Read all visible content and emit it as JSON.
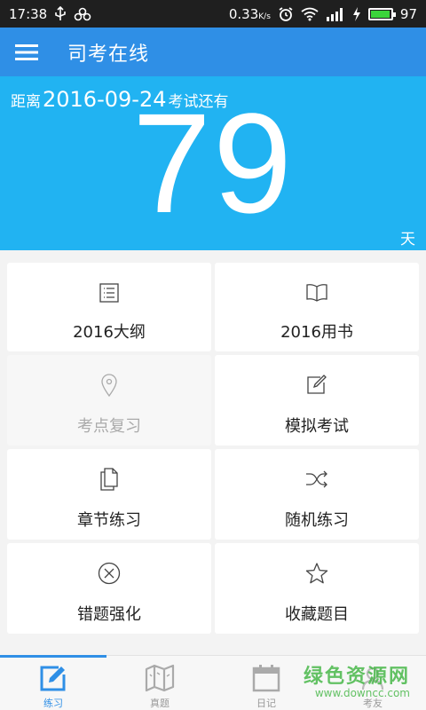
{
  "statusbar": {
    "time": "17:38",
    "speed": "0.33",
    "speed_unit": "K/s",
    "battery": "97",
    "battery_level": 0.97
  },
  "appbar": {
    "title": "司考在线"
  },
  "countdown": {
    "prefix": "距离",
    "date": "2016-09-24",
    "suffix": "考试还有",
    "days": "79",
    "unit": "天"
  },
  "grid": {
    "items": [
      {
        "label": "2016大纲",
        "icon": "list-icon"
      },
      {
        "label": "2016用书",
        "icon": "book-icon"
      },
      {
        "label": "考点复习",
        "icon": "location-pin-icon"
      },
      {
        "label": "模拟考试",
        "icon": "edit-icon"
      },
      {
        "label": "章节练习",
        "icon": "copy-icon"
      },
      {
        "label": "随机练习",
        "icon": "shuffle-icon"
      },
      {
        "label": "错题强化",
        "icon": "close-circle-icon"
      },
      {
        "label": "收藏题目",
        "icon": "star-icon"
      }
    ]
  },
  "bottomnav": {
    "tabs": [
      {
        "label": "练习",
        "icon": "pencil-icon",
        "active": true
      },
      {
        "label": "真题",
        "icon": "map-icon",
        "active": false
      },
      {
        "label": "日记",
        "icon": "calendar-icon",
        "active": false
      },
      {
        "label": "考友",
        "icon": "users-icon",
        "active": false
      }
    ]
  },
  "watermark": {
    "text": "绿色资源网",
    "url": "www.downcc.com"
  },
  "colors": {
    "appbar": "#2f8fe6",
    "countdown": "#21b3f2",
    "active_tab": "#2f8fe6"
  }
}
